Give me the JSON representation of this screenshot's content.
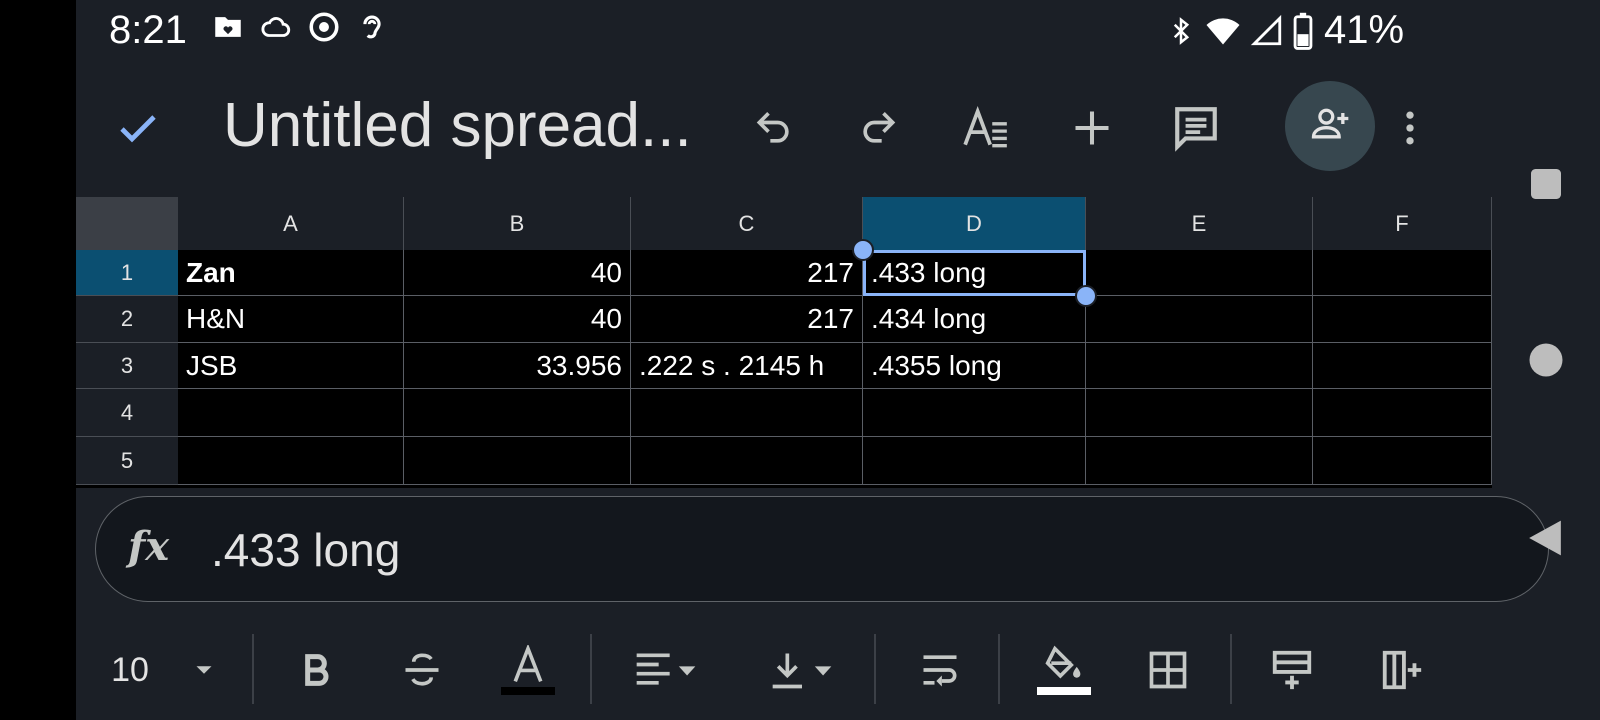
{
  "status_bar": {
    "time": "8:21",
    "battery": "41%",
    "left_icons": [
      "folder-heart-icon",
      "cloud-icon",
      "chrome-icon",
      "hearing-icon"
    ],
    "right_icons": [
      "bluetooth-icon",
      "wifi-icon",
      "signal-icon",
      "battery-icon"
    ]
  },
  "app_bar": {
    "title": "Untitled spread...",
    "icons": [
      "check-icon",
      "undo-icon",
      "redo-icon",
      "text-format-icon",
      "add-icon",
      "comment-icon",
      "share-add-person-icon",
      "more-vert-icon"
    ]
  },
  "grid": {
    "columns": [
      "A",
      "B",
      "C",
      "D",
      "E",
      "F"
    ],
    "rows": [
      "1",
      "2",
      "3",
      "4",
      "5"
    ],
    "cells": [
      [
        {
          "v": "Zan",
          "bold": true
        },
        {
          "v": "40",
          "num": true
        },
        {
          "v": "217",
          "num": true
        },
        {
          "v": ".433 long"
        },
        {
          "v": ""
        },
        {
          "v": ""
        }
      ],
      [
        {
          "v": "H&N"
        },
        {
          "v": "40",
          "num": true
        },
        {
          "v": "217",
          "num": true
        },
        {
          "v": ".434 long"
        },
        {
          "v": ""
        },
        {
          "v": ""
        }
      ],
      [
        {
          "v": "JSB"
        },
        {
          "v": "33.956",
          "num": true
        },
        {
          "v": ".222 s . 2145 h"
        },
        {
          "v": ".4355 long"
        },
        {
          "v": ""
        },
        {
          "v": ""
        }
      ],
      [
        {
          "v": ""
        },
        {
          "v": ""
        },
        {
          "v": ""
        },
        {
          "v": ""
        },
        {
          "v": ""
        },
        {
          "v": ""
        }
      ],
      [
        {
          "v": ""
        },
        {
          "v": ""
        },
        {
          "v": ""
        },
        {
          "v": ""
        },
        {
          "v": ""
        },
        {
          "v": ""
        }
      ]
    ],
    "selected_column": "D",
    "selected_row": "1"
  },
  "formula_bar": {
    "fx_label": "fx",
    "value": ".433 long"
  },
  "toolbar": {
    "font_size": "10",
    "icons": [
      "dropdown-arrow-icon",
      "bold-icon",
      "strikethrough-icon",
      "text-color-icon",
      "align-left-icon",
      "vertical-align-icon",
      "wrap-text-icon",
      "fill-color-icon",
      "borders-icon",
      "insert-row-icon",
      "insert-column-icon"
    ]
  },
  "colors": {
    "background": "#1b1f26",
    "selection": "#8ab4f8",
    "header_selected": "#0b4f71",
    "share_button": "#37474f"
  }
}
